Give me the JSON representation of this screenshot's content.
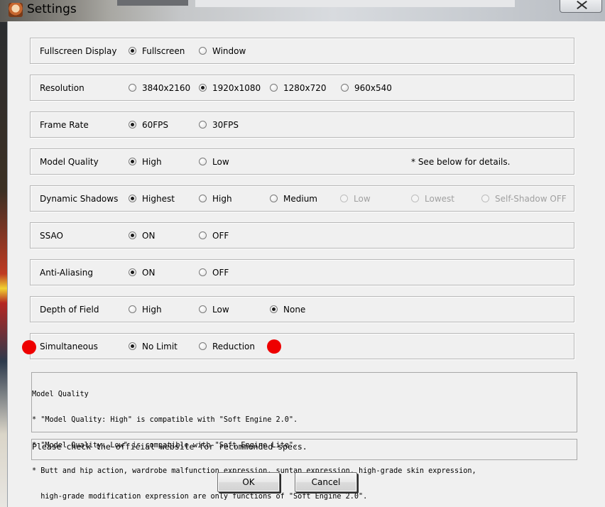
{
  "window": {
    "title": "Settings"
  },
  "rows": [
    {
      "label": "Fullscreen Display",
      "options": [
        {
          "text": "Fullscreen",
          "selected": true
        },
        {
          "text": "Window",
          "selected": false
        }
      ]
    },
    {
      "label": "Resolution",
      "options": [
        {
          "text": "3840x2160",
          "selected": false
        },
        {
          "text": "1920x1080",
          "selected": true
        },
        {
          "text": "1280x720",
          "selected": false
        },
        {
          "text": "960x540",
          "selected": false
        }
      ]
    },
    {
      "label": "Frame Rate",
      "options": [
        {
          "text": "60FPS",
          "selected": true
        },
        {
          "text": "30FPS",
          "selected": false
        }
      ]
    },
    {
      "label": "Model Quality",
      "options": [
        {
          "text": "High",
          "selected": true
        },
        {
          "text": "Low",
          "selected": false
        }
      ],
      "note": "* See below for details."
    },
    {
      "label": "Dynamic Shadows",
      "options": [
        {
          "text": "Highest",
          "selected": true
        },
        {
          "text": "High",
          "selected": false
        },
        {
          "text": "Medium",
          "selected": false
        },
        {
          "text": "Low",
          "selected": false,
          "disabled": true
        },
        {
          "text": "Lowest",
          "selected": false,
          "disabled": true
        },
        {
          "text": "Self-Shadow OFF",
          "selected": false,
          "disabled": true
        }
      ]
    },
    {
      "label": "SSAO",
      "options": [
        {
          "text": "ON",
          "selected": true
        },
        {
          "text": "OFF",
          "selected": false
        }
      ]
    },
    {
      "label": "Anti-Aliasing",
      "options": [
        {
          "text": "ON",
          "selected": true
        },
        {
          "text": "OFF",
          "selected": false
        }
      ]
    },
    {
      "label": "Depth of Field",
      "options": [
        {
          "text": "High",
          "selected": false
        },
        {
          "text": "Low",
          "selected": false
        },
        {
          "text": "None",
          "selected": true
        }
      ]
    },
    {
      "label": "Simultaneous",
      "options": [
        {
          "text": "No Limit",
          "selected": true
        },
        {
          "text": "Reduction",
          "selected": false
        }
      ]
    }
  ],
  "notes": [
    "Model Quality",
    "* \"Model Quality: High\" is compatible with \"Soft Engine 2.0\".",
    "* \"Model Quality: Low\" is compatible with \"Soft Engine Lite\".",
    "* Butt and hip action, wardrobe malfunction expression, suntan expression, high-grade skin expression,",
    "  high-grade modification expression are only functions of \"Soft Engine 2.0\"."
  ],
  "spec_message": "Please check the official website for recommended specs.",
  "buttons": {
    "ok": "OK",
    "cancel": "Cancel"
  },
  "colors": {
    "marker": "#ee0000",
    "dialog_bg": "#f0f0f0"
  }
}
